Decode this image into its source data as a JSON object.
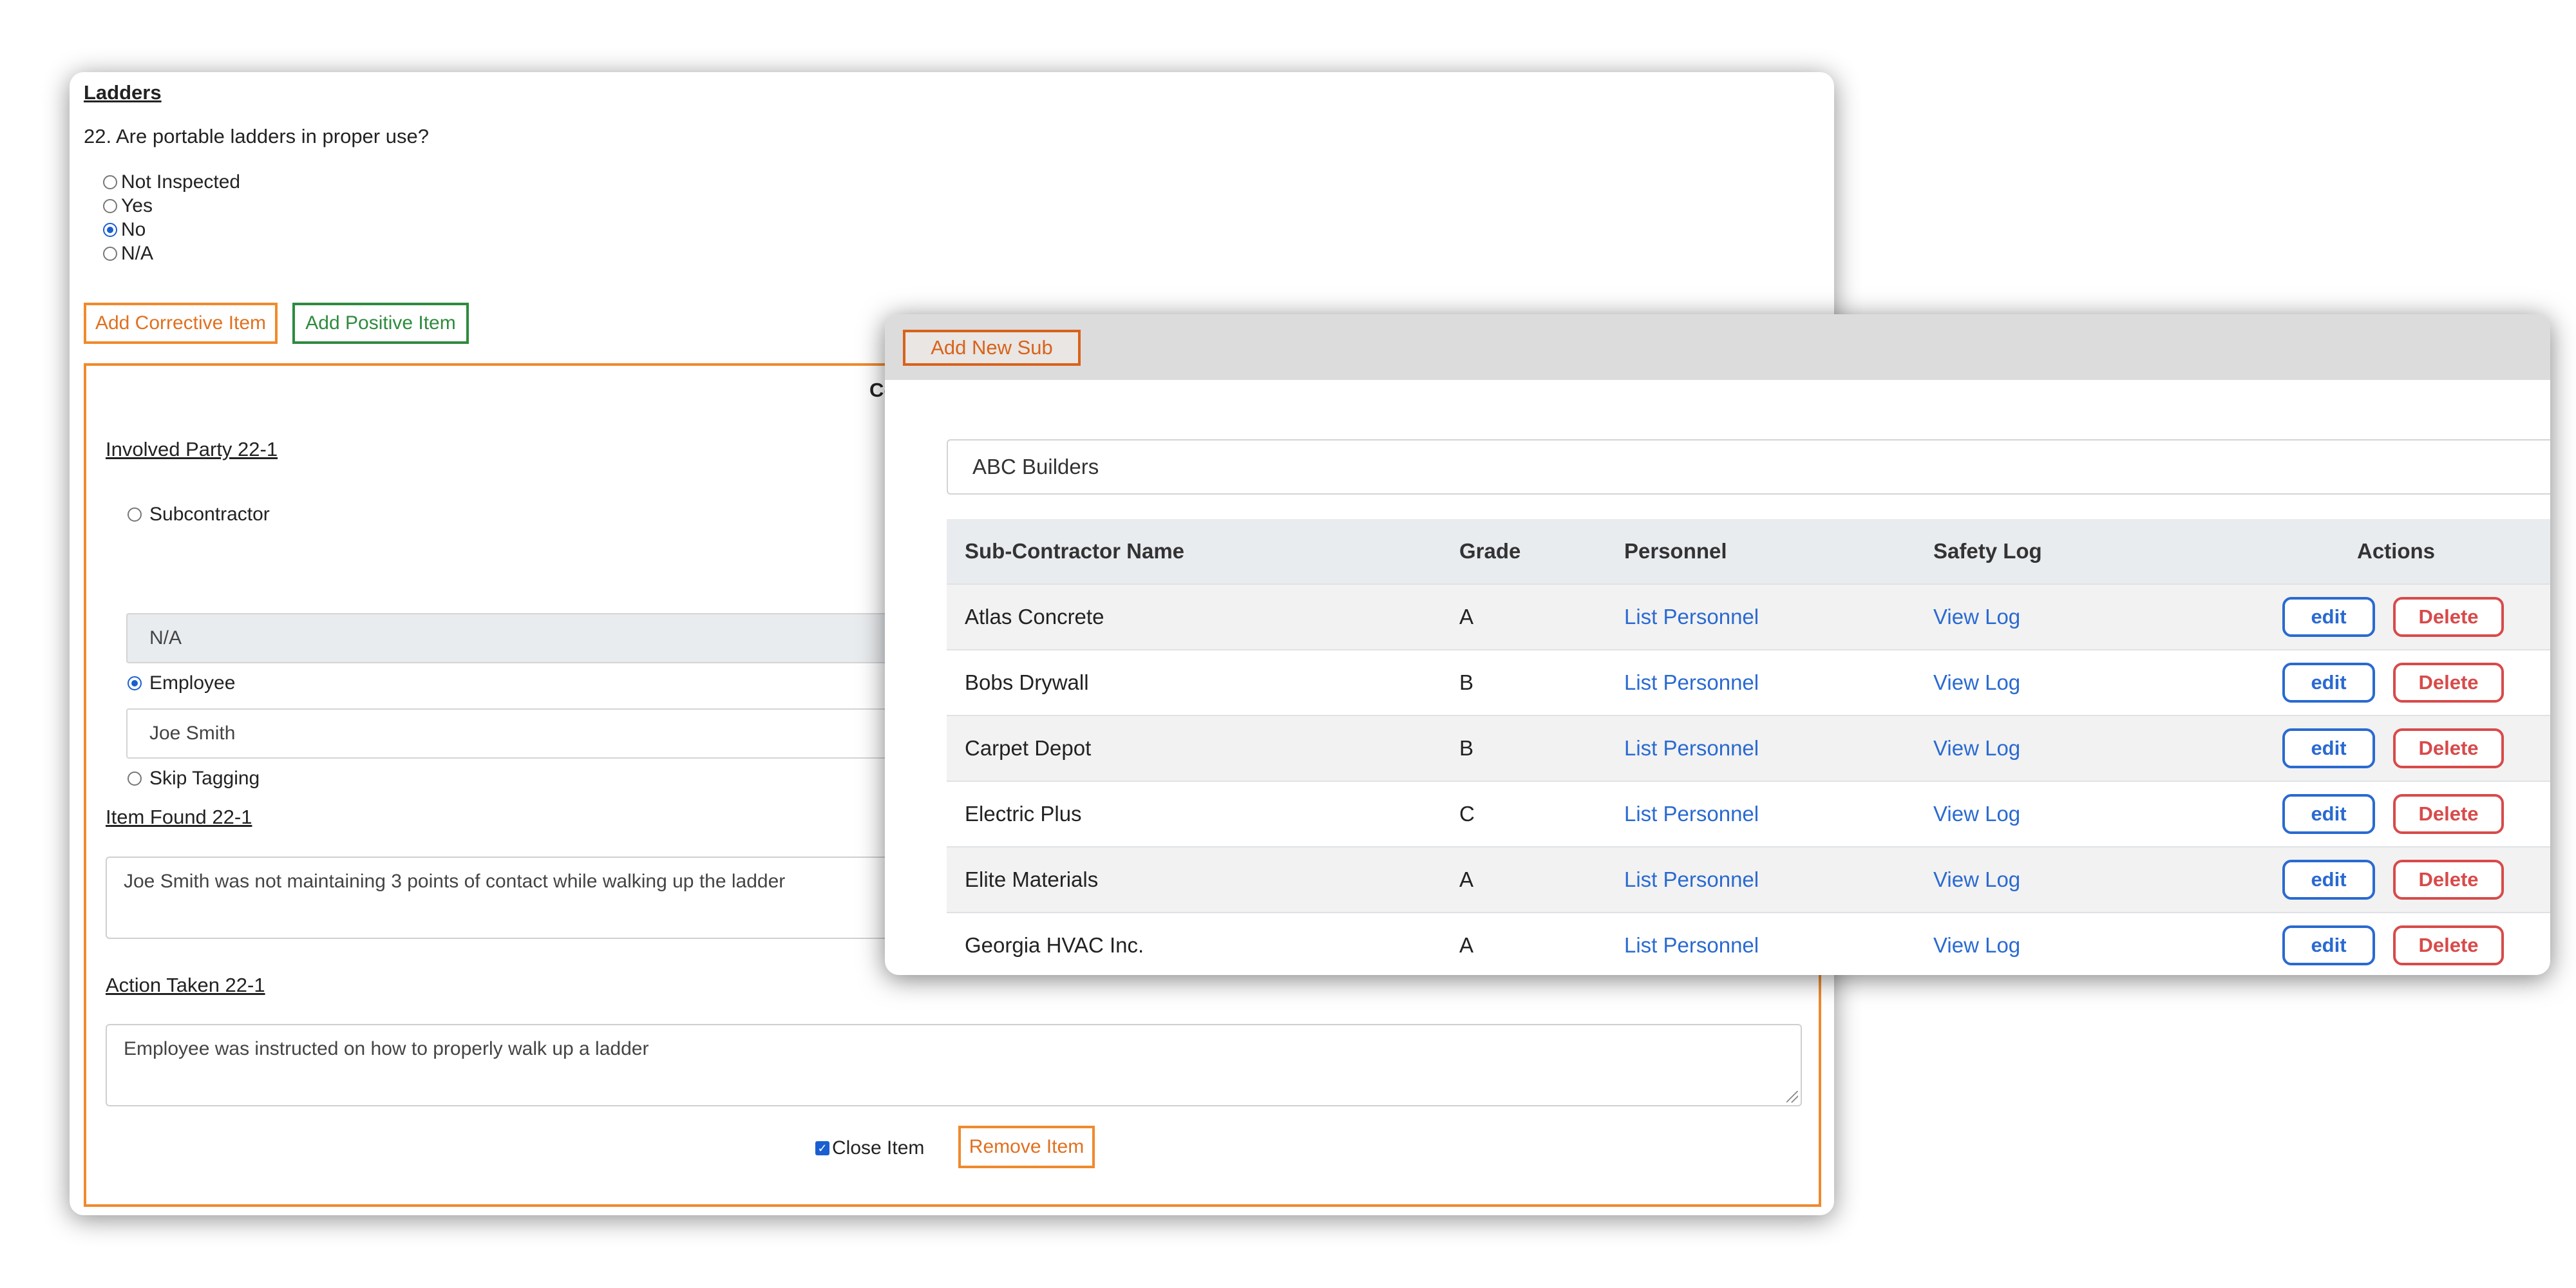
{
  "inspection": {
    "section_title": "Ladders",
    "question": "22. Are portable ladders in proper use?",
    "options": [
      {
        "label": "Not Inspected",
        "checked": false
      },
      {
        "label": "Yes",
        "checked": false
      },
      {
        "label": "No",
        "checked": true
      },
      {
        "label": "N/A",
        "checked": false
      }
    ],
    "add_corrective_label": "Add Corrective Item",
    "add_positive_label": "Add Positive Item",
    "corrective": {
      "heading_partial": "Co",
      "involved_party_label": "Involved Party 22-1",
      "subcontractor_label": "Subcontractor",
      "subcontractor_value": "N/A",
      "employee_label": "Employee",
      "employee_value": "Joe Smith",
      "skip_tagging_label": "Skip Tagging",
      "selected_party": "Employee",
      "item_found_label": "Item Found 22-1",
      "item_found_value": "Joe Smith was not maintaining 3 points of contact while walking up the ladder",
      "action_taken_label": "Action Taken 22-1",
      "action_taken_value": "Employee was instructed on how to properly walk up a ladder",
      "close_item_label": "Close Item",
      "close_item_checked": true,
      "remove_item_label": "Remove Item"
    }
  },
  "subs": {
    "add_new_label": "Add New Sub",
    "search_value": "ABC Builders",
    "columns": {
      "name": "Sub-Contractor Name",
      "grade": "Grade",
      "personnel": "Personnel",
      "safety_log": "Safety Log",
      "actions": "Actions"
    },
    "rows": [
      {
        "name": "Atlas Concrete",
        "grade": "A",
        "personnel": "List Personnel",
        "log": "View Log",
        "edit": "edit",
        "delete": "Delete"
      },
      {
        "name": "Bobs Drywall",
        "grade": "B",
        "personnel": "List Personnel",
        "log": "View Log",
        "edit": "edit",
        "delete": "Delete"
      },
      {
        "name": "Carpet Depot",
        "grade": "B",
        "personnel": "List Personnel",
        "log": "View Log",
        "edit": "edit",
        "delete": "Delete"
      },
      {
        "name": "Electric Plus",
        "grade": "C",
        "personnel": "List Personnel",
        "log": "View Log",
        "edit": "edit",
        "delete": "Delete"
      },
      {
        "name": "Elite Materials",
        "grade": "A",
        "personnel": "List Personnel",
        "log": "View Log",
        "edit": "edit",
        "delete": "Delete"
      },
      {
        "name": "Georgia HVAC Inc.",
        "grade": "A",
        "personnel": "List Personnel",
        "log": "View Log",
        "edit": "edit",
        "delete": "Delete"
      }
    ]
  },
  "colors": {
    "corrective_orange": "#f08a2c",
    "positive_green": "#2e8b3e",
    "link_blue": "#2a6ad1",
    "delete_red": "#d84a4a"
  }
}
